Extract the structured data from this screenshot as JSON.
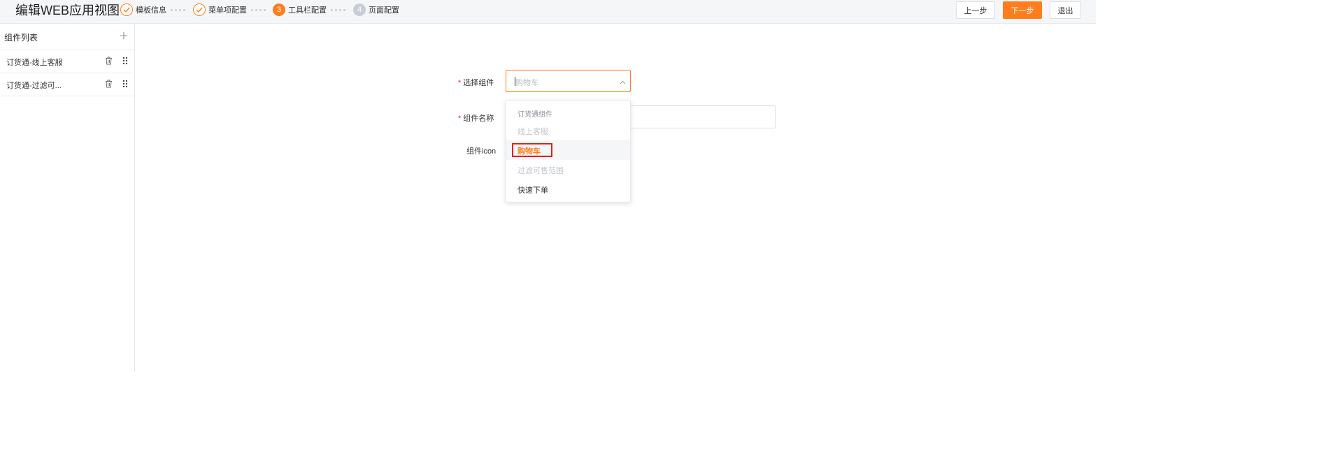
{
  "header": {
    "title": "编辑WEB应用视图",
    "steps": [
      {
        "label": "模板信息",
        "status": "done"
      },
      {
        "label": "菜单项配置",
        "status": "done"
      },
      {
        "number": "3",
        "label": "工具栏配置",
        "status": "current"
      },
      {
        "number": "4",
        "label": "页面配置",
        "status": "todo"
      }
    ],
    "buttons": {
      "prev": "上一步",
      "next": "下一步",
      "exit": "退出"
    }
  },
  "sidebar": {
    "title": "组件列表",
    "items": [
      {
        "label": "订货通-线上客服"
      },
      {
        "label": "订货通-过滤可..."
      }
    ]
  },
  "form": {
    "select_component": {
      "label": "选择组件",
      "placeholder": "购物车"
    },
    "component_name": {
      "label": "组件名称"
    },
    "component_icon": {
      "label": "组件icon"
    }
  },
  "dropdown": {
    "group": "订货通组件",
    "options": [
      {
        "label": "线上客服",
        "state": "disabled"
      },
      {
        "label": "购物车",
        "state": "selected"
      },
      {
        "label": "过滤可售范围",
        "state": "disabled"
      },
      {
        "label": "快速下单",
        "state": "normal"
      }
    ]
  },
  "colors": {
    "accent": "#ff7d1f",
    "required": "#f5222d",
    "highlight_box": "#e02020",
    "disabled_text": "#c0c4cc"
  }
}
